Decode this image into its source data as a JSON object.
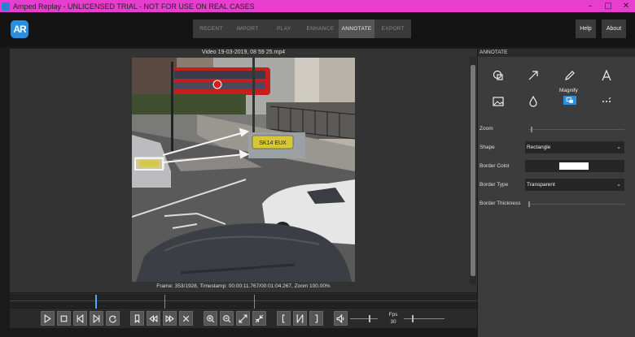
{
  "window": {
    "title": "Amped Replay - UNLICENSED TRIAL - NOT FOR USE ON REAL CASES",
    "controls": [
      "–",
      "□",
      "✕"
    ]
  },
  "logo": {
    "text": "AR"
  },
  "tabs": [
    {
      "label": "RECENT",
      "active": false
    },
    {
      "label": "IMPORT",
      "active": false
    },
    {
      "label": "PLAY",
      "active": false
    },
    {
      "label": "ENHANCE",
      "active": false
    },
    {
      "label": "ANNOTATE",
      "active": true
    },
    {
      "label": "EXPORT",
      "active": false
    }
  ],
  "header": {
    "help_label": "Help",
    "about_label": "About"
  },
  "viewer": {
    "video_title": "Video 19-03-2019, 08 59 25.mp4",
    "frame_info": "Frame: 353/1928, Timestamp: 00:00:11.767/00:01:04.267,  Zoom 100.00%",
    "plate_text": "SK14 EUX"
  },
  "playback": {
    "fps_label": "Fps",
    "fps_value": "30",
    "position_fraction": 0.183
  },
  "panel": {
    "title": "ANNOTATE",
    "tools": [
      "shape-icon",
      "arrow-icon",
      "pencil-icon",
      "text-icon",
      "image-icon",
      "blur-drop-icon",
      "magnify-icon",
      "more-icon"
    ],
    "selected_tool_label": "Magnify",
    "zoom_label": "Zoom",
    "shape_label": "Shape",
    "shape_value": "Rectangle",
    "border_color_label": "Border Color",
    "border_color": "#ffffff",
    "border_type_label": "Border Type",
    "border_type_value": "Transparent",
    "border_thickness_label": "Border Thickness"
  },
  "colors": {
    "accent": "#2b8fe0",
    "title_bar": "#e83ed0",
    "selected_tab": "#555555"
  }
}
